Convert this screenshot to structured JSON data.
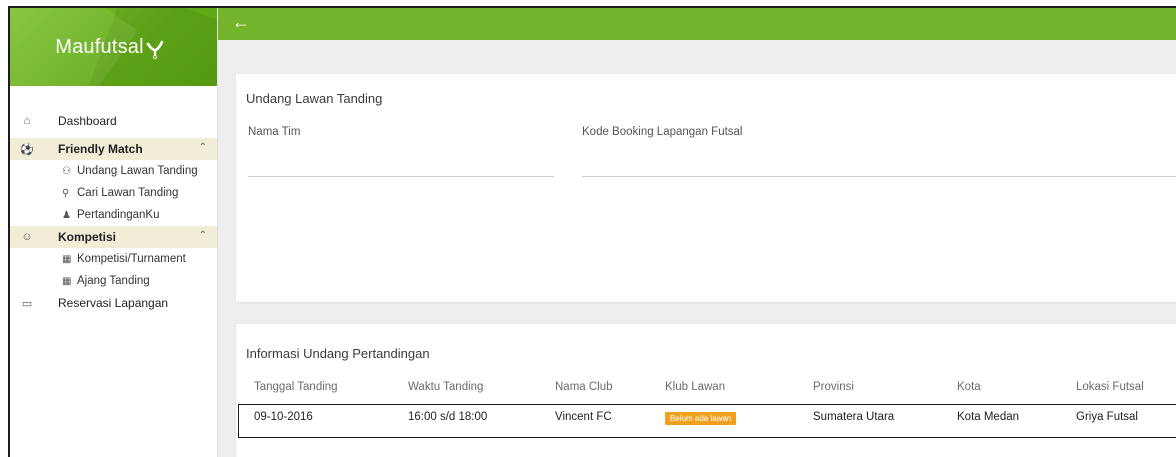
{
  "brand": {
    "name": "Maufutsal",
    "logo_icon": "futsal-player-icon"
  },
  "topbar": {
    "back_icon": "arrow-left-icon",
    "back_glyph": "←",
    "color": "#72b52a"
  },
  "sidebar": {
    "dashboard": {
      "label": "Dashboard",
      "icon": "home-icon"
    },
    "friendly_match": {
      "label": "Friendly Match",
      "icon": "soccer-ball-icon",
      "items": [
        {
          "label": "Undang Lawan Tanding",
          "icon": "add-user-icon"
        },
        {
          "label": "Cari Lawan Tanding",
          "icon": "search-icon"
        },
        {
          "label": "PertandinganKu",
          "icon": "user-icon"
        }
      ]
    },
    "kompetisi": {
      "label": "Kompetisi",
      "icon": "group-icon",
      "items": [
        {
          "label": "Kompetisi/Turnament",
          "icon": "calendar-icon"
        },
        {
          "label": "Ajang Tanding",
          "icon": "calendar-icon"
        }
      ]
    },
    "reservasi": {
      "label": "Reservasi Lapangan",
      "icon": "monitor-icon"
    }
  },
  "form": {
    "title": "Undang Lawan Tanding",
    "team_name_label": "Nama Tim",
    "booking_code_label": "Kode Booking Lapangan Futsal",
    "team_name_value": "",
    "booking_code_value": ""
  },
  "table": {
    "title": "Informasi Undang Pertandingan",
    "headers": [
      "Tanggal Tanding",
      "Waktu Tanding",
      "Nama Club",
      "Klub Lawan",
      "Provinsi",
      "Kota",
      "Lokasi Futsal"
    ],
    "rows": [
      {
        "tanggal": "09-10-2016",
        "waktu": "16:00 s/d 18:00",
        "club": "Vincent FC",
        "lawan": "Belum ada lawan",
        "provinsi": "Sumatera Utara",
        "kota": "Kota Medan",
        "lokasi": "Griya Futsal"
      }
    ]
  },
  "colors": {
    "accent": "#72b52a",
    "section_bg": "#f2edd6",
    "badge": "#f0a120"
  }
}
